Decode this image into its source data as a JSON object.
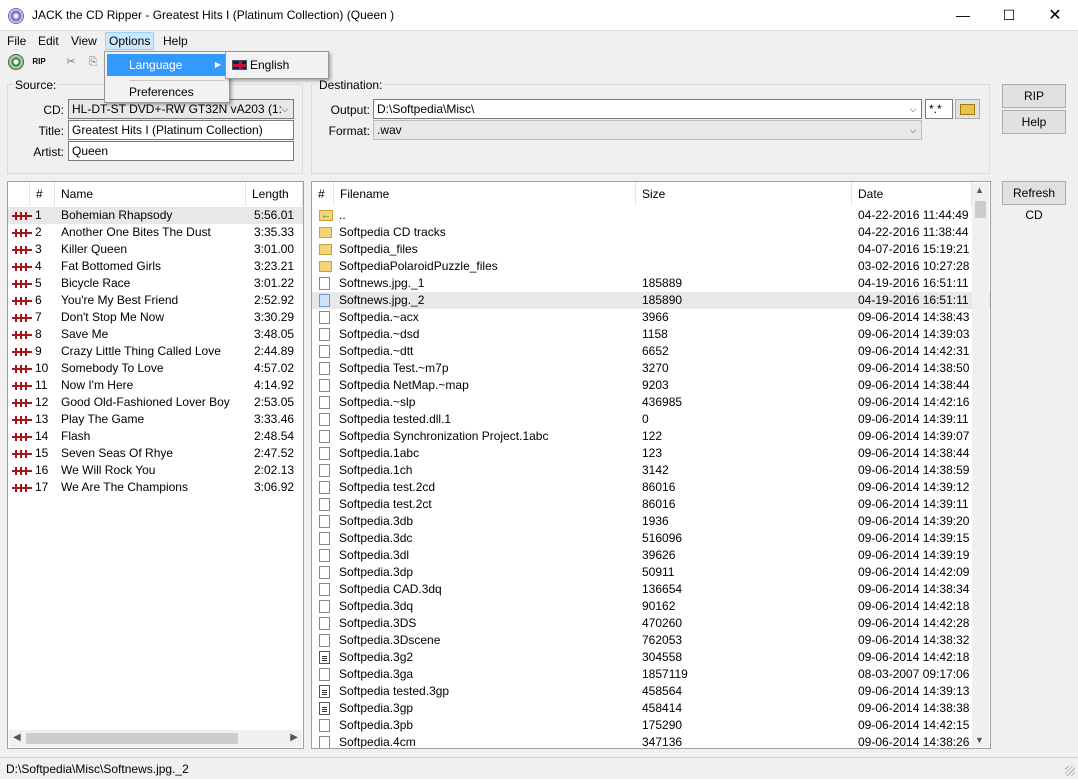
{
  "window": {
    "title": "JACK the CD Ripper - Greatest Hits I (Platinum  Collection) (Queen )",
    "minimize": "—",
    "maximize": "☐",
    "close": "✕"
  },
  "menubar": [
    "File",
    "Edit",
    "View",
    "Options",
    "Help"
  ],
  "toolbar": {
    "rip_label": "RIP",
    "cut": "✂",
    "copy": "⎘"
  },
  "options_menu": {
    "items": [
      "Language",
      "Preferences"
    ],
    "language_submenu": [
      "English"
    ]
  },
  "source": {
    "group_title": "Source:",
    "cd_label": "CD:",
    "cd_value": "HL-DT-ST  DVD+-RW GT32N    vA203 (1:",
    "title_label": "Title:",
    "title_value": "Greatest Hits I (Platinum  Collection)",
    "artist_label": "Artist:",
    "artist_value": "Queen"
  },
  "destination": {
    "group_title": "Destination:",
    "output_label": "Output:",
    "output_value": "D:\\Softpedia\\Misc\\",
    "filter_value": "*.*",
    "format_label": "Format:",
    "format_value": ".wav"
  },
  "buttons": {
    "rip": "RIP",
    "help": "Help",
    "refresh": "Refresh CD"
  },
  "tracks": {
    "columns": [
      "#",
      "Name",
      "Length"
    ],
    "rows": [
      {
        "n": "1",
        "name": "Bohemian Rhapsody",
        "length": "5:56.01"
      },
      {
        "n": "2",
        "name": "Another One Bites The Dust",
        "length": "3:35.33"
      },
      {
        "n": "3",
        "name": "Killer Queen",
        "length": "3:01.00"
      },
      {
        "n": "4",
        "name": "Fat Bottomed Girls",
        "length": "3:23.21"
      },
      {
        "n": "5",
        "name": "Bicycle Race",
        "length": "3:01.22"
      },
      {
        "n": "6",
        "name": "You're My Best Friend",
        "length": "2:52.92"
      },
      {
        "n": "7",
        "name": "Don't Stop Me Now",
        "length": "3:30.29"
      },
      {
        "n": "8",
        "name": "Save Me",
        "length": "3:48.05"
      },
      {
        "n": "9",
        "name": "Crazy Little Thing Called Love",
        "length": "2:44.89"
      },
      {
        "n": "10",
        "name": "Somebody To Love",
        "length": "4:57.02"
      },
      {
        "n": "11",
        "name": "Now I'm Here",
        "length": "4:14.92"
      },
      {
        "n": "12",
        "name": "Good Old-Fashioned Lover Boy",
        "length": "2:53.05"
      },
      {
        "n": "13",
        "name": "Play The Game",
        "length": "3:33.46"
      },
      {
        "n": "14",
        "name": "Flash",
        "length": "2:48.54"
      },
      {
        "n": "15",
        "name": "Seven Seas Of Rhye",
        "length": "2:47.52"
      },
      {
        "n": "16",
        "name": "We Will Rock You",
        "length": "2:02.13"
      },
      {
        "n": "17",
        "name": "We Are The Champions",
        "length": "3:06.92"
      }
    ]
  },
  "files": {
    "columns": [
      "#",
      "Filename",
      "Size",
      "Date"
    ],
    "rows": [
      {
        "icon": "up",
        "name": "..",
        "size": "",
        "date": "04-22-2016 11:44:49"
      },
      {
        "icon": "folder",
        "name": "Softpedia CD tracks",
        "size": "",
        "date": "04-22-2016 11:38:44"
      },
      {
        "icon": "folder",
        "name": "Softpedia_files",
        "size": "",
        "date": "04-07-2016 15:19:21"
      },
      {
        "icon": "folder",
        "name": "SoftpediaPolaroidPuzzle_files",
        "size": "",
        "date": "03-02-2016 10:27:28"
      },
      {
        "icon": "doc",
        "name": "Softnews.jpg._1",
        "size": "185889",
        "date": "04-19-2016 16:51:11"
      },
      {
        "icon": "doc-sel",
        "name": "Softnews.jpg._2",
        "size": "185890",
        "date": "04-19-2016 16:51:11"
      },
      {
        "icon": "doc",
        "name": "Softpedia.~acx",
        "size": "3966",
        "date": "09-06-2014 14:38:43"
      },
      {
        "icon": "doc",
        "name": "Softpedia.~dsd",
        "size": "1158",
        "date": "09-06-2014 14:39:03"
      },
      {
        "icon": "doc",
        "name": "Softpedia.~dtt",
        "size": "6652",
        "date": "09-06-2014 14:42:31"
      },
      {
        "icon": "doc",
        "name": "Softpedia Test.~m7p",
        "size": "3270",
        "date": "09-06-2014 14:38:50"
      },
      {
        "icon": "doc",
        "name": "Softpedia NetMap.~map",
        "size": "9203",
        "date": "09-06-2014 14:38:44"
      },
      {
        "icon": "doc",
        "name": "Softpedia.~slp",
        "size": "436985",
        "date": "09-06-2014 14:42:16"
      },
      {
        "icon": "doc",
        "name": "Softpedia tested.dll.1",
        "size": "0",
        "date": "09-06-2014 14:39:11"
      },
      {
        "icon": "doc",
        "name": "Softpedia Synchronization Project.1abc",
        "size": "122",
        "date": "09-06-2014 14:39:07"
      },
      {
        "icon": "doc",
        "name": "Softpedia.1abc",
        "size": "123",
        "date": "09-06-2014 14:38:44"
      },
      {
        "icon": "doc",
        "name": "Softpedia.1ch",
        "size": "3142",
        "date": "09-06-2014 14:38:59"
      },
      {
        "icon": "doc",
        "name": "Softpedia test.2cd",
        "size": "86016",
        "date": "09-06-2014 14:39:12"
      },
      {
        "icon": "doc",
        "name": "Softpedia test.2ct",
        "size": "86016",
        "date": "09-06-2014 14:39:11"
      },
      {
        "icon": "doc",
        "name": "Softpedia.3db",
        "size": "1936",
        "date": "09-06-2014 14:39:20"
      },
      {
        "icon": "doc",
        "name": "Softpedia.3dc",
        "size": "516096",
        "date": "09-06-2014 14:39:15"
      },
      {
        "icon": "doc",
        "name": "Softpedia.3dl",
        "size": "39626",
        "date": "09-06-2014 14:39:19"
      },
      {
        "icon": "doc",
        "name": "Softpedia.3dp",
        "size": "50911",
        "date": "09-06-2014 14:42:09"
      },
      {
        "icon": "doc",
        "name": "Softpedia CAD.3dq",
        "size": "136654",
        "date": "09-06-2014 14:38:34"
      },
      {
        "icon": "doc",
        "name": "Softpedia.3dq",
        "size": "90162",
        "date": "09-06-2014 14:42:18"
      },
      {
        "icon": "doc",
        "name": "Softpedia.3DS",
        "size": "470260",
        "date": "09-06-2014 14:42:28"
      },
      {
        "icon": "doc",
        "name": "Softpedia.3Dscene",
        "size": "762053",
        "date": "09-06-2014 14:38:32"
      },
      {
        "icon": "dark",
        "name": "Softpedia.3g2",
        "size": "304558",
        "date": "09-06-2014 14:42:18"
      },
      {
        "icon": "doc",
        "name": "Softpedia.3ga",
        "size": "1857119",
        "date": "08-03-2007 09:17:06"
      },
      {
        "icon": "dark",
        "name": "Softpedia tested.3gp",
        "size": "458564",
        "date": "09-06-2014 14:39:13"
      },
      {
        "icon": "dark",
        "name": "Softpedia.3gp",
        "size": "458414",
        "date": "09-06-2014 14:38:38"
      },
      {
        "icon": "doc",
        "name": "Softpedia.3pb",
        "size": "175290",
        "date": "09-06-2014 14:42:15"
      },
      {
        "icon": "doc",
        "name": "Softpedia.4cm",
        "size": "347136",
        "date": "09-06-2014 14:38:26"
      }
    ]
  },
  "status": {
    "path": "D:\\Softpedia\\Misc\\Softnews.jpg._2"
  }
}
